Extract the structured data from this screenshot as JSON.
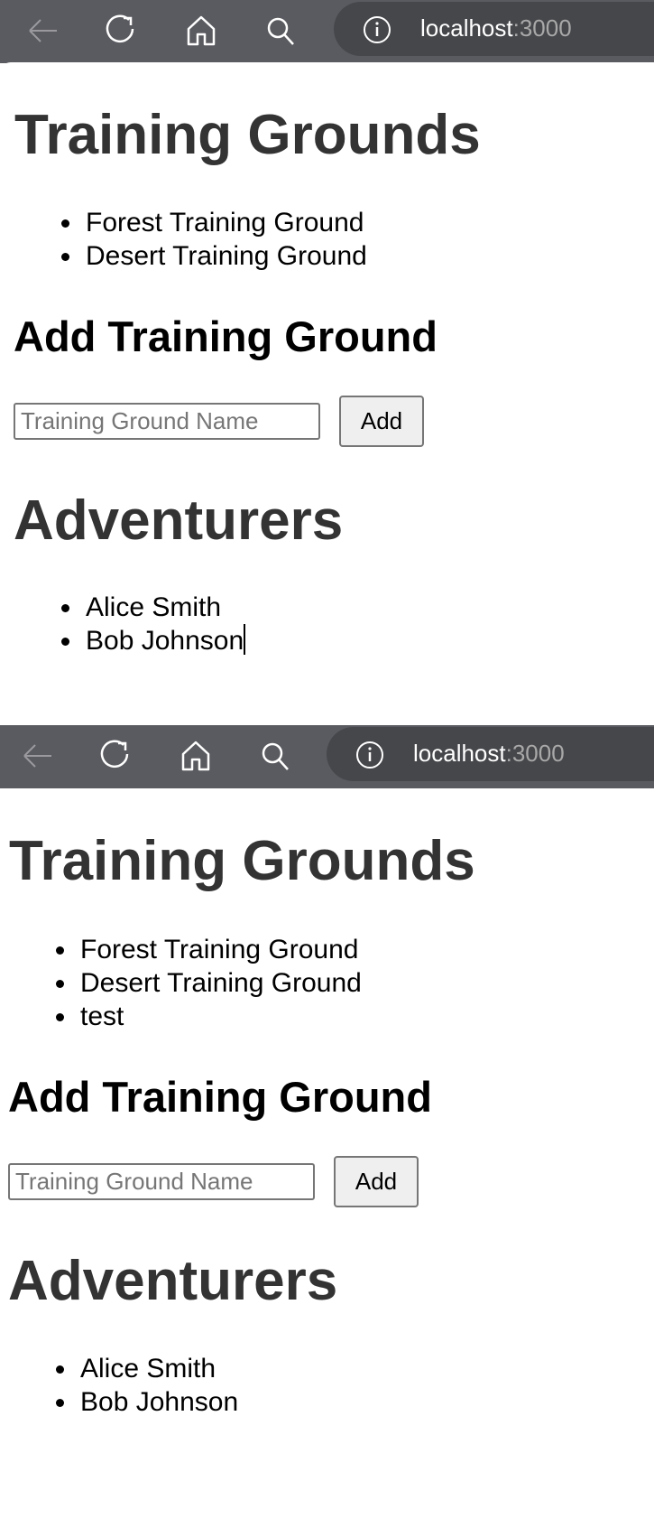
{
  "browser": {
    "host": "localhost",
    "port": ":3000"
  },
  "panels": [
    {
      "title": "Training Grounds",
      "grounds": [
        "Forest Training Ground",
        "Desert Training Ground"
      ],
      "add_heading": "Add Training Ground",
      "input_placeholder": "Training Ground Name",
      "add_label": "Add",
      "adventurers_title": "Adventurers",
      "adventurers": [
        "Alice Smith",
        "Bob Johnson"
      ]
    },
    {
      "title": "Training Grounds",
      "grounds": [
        "Forest Training Ground",
        "Desert Training Ground",
        "test"
      ],
      "add_heading": "Add Training Ground",
      "input_placeholder": "Training Ground Name",
      "add_label": "Add",
      "adventurers_title": "Adventurers",
      "adventurers": [
        "Alice Smith",
        "Bob Johnson"
      ]
    }
  ]
}
